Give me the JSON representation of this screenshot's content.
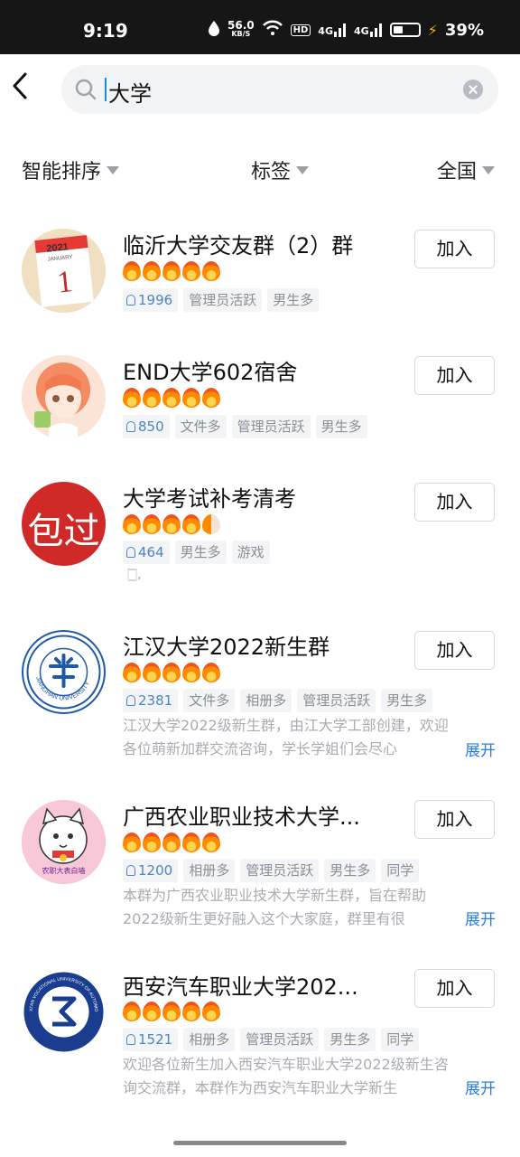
{
  "status_bar": {
    "time": "9:19",
    "net_speed_value": "56.0",
    "net_speed_unit": "KB/S",
    "hd_label": "HD",
    "signal_1": "4G",
    "signal_2": "4G",
    "battery_percent": "39%",
    "battery_level": 0.39
  },
  "search": {
    "query": "大学"
  },
  "filters": {
    "sort": "智能排序",
    "tags": "标签",
    "region": "全国"
  },
  "join_label": "加入",
  "expand_label": "展开",
  "groups": [
    {
      "name": "临沂大学交友群（2）群",
      "members": "1996",
      "tags": [
        "管理员活跃",
        "男生多"
      ],
      "heat": 5,
      "avatar": {
        "type": "calendar",
        "year": "2021",
        "month": "JANUARY",
        "day": "1"
      }
    },
    {
      "name": "END大学602宿舍",
      "members": "850",
      "tags": [
        "文件多",
        "管理员活跃",
        "男生多"
      ],
      "heat": 5,
      "avatar": {
        "type": "anime-girl"
      }
    },
    {
      "name": "大学考试补考清考",
      "members": "464",
      "tags": [
        "男生多",
        "游戏"
      ],
      "heat": 4.5,
      "extra_glyph": "🀆,",
      "avatar": {
        "type": "text",
        "text": "包过",
        "color": "#d32f2f"
      }
    },
    {
      "name": "江汉大学2022新生群",
      "members": "2381",
      "tags": [
        "文件多",
        "相册多",
        "管理员活跃",
        "男生多"
      ],
      "heat": 5,
      "desc": [
        "江汉大学2022级新生群，由江大学工部创建，欢迎",
        "各位萌新加群交流咨询，学长学姐们会尽心"
      ],
      "avatar": {
        "type": "emblem",
        "caption": "JIANGHAN UNIVERSITY",
        "color": "#1e5aa8"
      }
    },
    {
      "name": "广西农业职业技术大学...",
      "members": "1200",
      "tags": [
        "相册多",
        "管理员活跃",
        "男生多",
        "同学"
      ],
      "heat": 5,
      "desc": [
        "本群为广西农业职业技术大学新生群，旨在帮助",
        "2022级新生更好融入这个大家庭，群里有很"
      ],
      "avatar": {
        "type": "lucky-cat",
        "caption": "农职大表白墙",
        "color": "#f8c8d8"
      }
    },
    {
      "name": "西安汽车职业大学202...",
      "members": "1521",
      "tags": [
        "相册多",
        "管理员活跃",
        "男生多",
        "同学"
      ],
      "heat": 5,
      "desc": [
        "欢迎各位新生加入西安汽车职业大学2022级新生咨",
        "询交流群，本群作为西安汽车职业大学新生"
      ],
      "avatar": {
        "type": "emblem",
        "caption": "XI'AN VOCATIONAL UNIVERSITY OF AUTOMOBILE",
        "color": "#1a3d8f"
      }
    }
  ]
}
